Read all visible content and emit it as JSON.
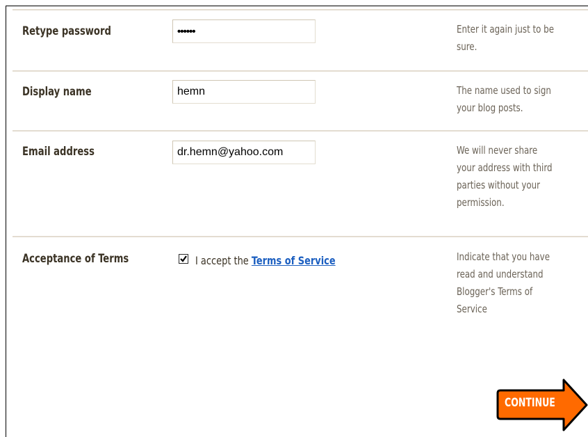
{
  "rows": [
    {
      "label": "Retype password",
      "value": "••••••",
      "help": [
        "Enter it again just to be",
        "sure."
      ]
    },
    {
      "label": "Display name",
      "value": "hemn",
      "help": [
        "The name used to sign",
        "your blog posts."
      ]
    },
    {
      "label": "Email address",
      "value": "dr.hemn@yahoo.com",
      "help": [
        "We will never share",
        "your address with third",
        "parties without your",
        "permission."
      ]
    }
  ],
  "terms": {
    "label": "Acceptance of Terms",
    "checked": true,
    "accept_prefix": "I accept the",
    "link_text": "Terms of Service",
    "help": [
      "Indicate that you have",
      "read and understand",
      "Blogger's Terms of",
      "Service"
    ]
  },
  "continue_button": {
    "label": "CONTINUE"
  },
  "colors": {
    "label": "#3b3325",
    "help": "#6b6357",
    "link": "#1c5fc0",
    "separator": "#e3dcd0",
    "button_fill": "#ff6a00",
    "button_outline": "#000000"
  }
}
